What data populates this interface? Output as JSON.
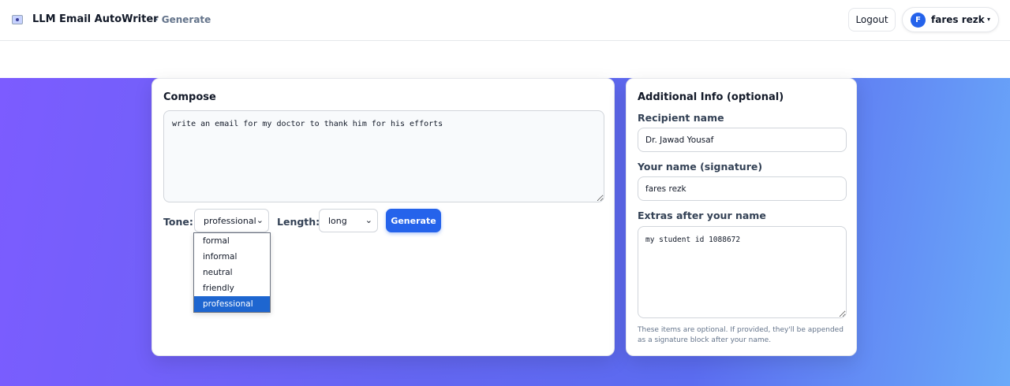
{
  "header": {
    "app_title": "LLM Email AutoWriter",
    "crumb": "· Generate",
    "logout_label": "Logout",
    "user": {
      "initial": "F",
      "name": "fares rezk",
      "caret": "▾"
    }
  },
  "compose": {
    "title": "Compose",
    "prompt_value": "write an email for my doctor to thank him for his efforts",
    "tone_label": "Tone:",
    "tone_value": "professional",
    "tone_options": [
      "formal",
      "informal",
      "neutral",
      "friendly",
      "professional"
    ],
    "length_label": "Length:",
    "length_value": "long",
    "generate_label": "Generate"
  },
  "additional": {
    "title": "Additional Info (optional)",
    "recipient_label": "Recipient name",
    "recipient_value": "Dr. Jawad Yousaf",
    "signature_label": "Your name (signature)",
    "signature_value": "fares rezk",
    "extras_label": "Extras after your name",
    "extras_value": "my student id 1088672",
    "hint": "These items are optional. If provided, they'll be appended as a signature block after your name."
  },
  "colors": {
    "accent": "#2563eb",
    "gradient_start": "#7c5cff",
    "gradient_end": "#6aaaf9",
    "selected_option": "#1e66d0"
  }
}
